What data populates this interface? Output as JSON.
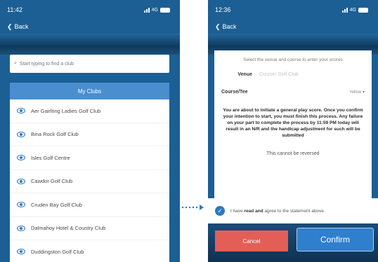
{
  "left_screen": {
    "status_time": "11:42",
    "status_network": "4G",
    "back_label": "Back",
    "search": {
      "placeholder": "Start typing to find a club"
    },
    "list_header": "My Clubs",
    "clubs": [
      {
        "name": "Aer Gairlting Ladies Golf Club"
      },
      {
        "name": "Bina Rock Golf Club"
      },
      {
        "name": "Isles Golf Centre"
      },
      {
        "name": "Cawdor Golf Club"
      },
      {
        "name": "Cruden Bay Golf Club"
      },
      {
        "name": "Dalmahoy Hotel & Country Club"
      },
      {
        "name": "Duddingston Golf Club"
      }
    ]
  },
  "right_screen": {
    "status_time": "12:36",
    "status_network": "4G",
    "back_label": "Back",
    "intro": "Select the venue and course to enter your scores",
    "venue_label": "Venue",
    "venue_placeholder": "Course/ Golf Club",
    "course_label": "Course/Tee",
    "course_value": "Yellow",
    "warning": "You are about to initiate a general play score. Once you confirm your intention to start, you must finish this process. Any failure on your part to complete the process by 11:59 PM today will result in an N/R and the handicap adjustment for such will be submitted",
    "irreversible": "This cannot be reversed",
    "agree_prefix": "I have",
    "agree_bold": "read and",
    "agree_suffix": "agree to the statement above",
    "cancel_label": "Cancel",
    "confirm_label": "Confirm"
  },
  "colors": {
    "header_blue": "#1b5f94",
    "accent_blue": "#2e78c2",
    "cancel_red": "#e35e57",
    "list_header_blue": "#4a8ed0"
  }
}
